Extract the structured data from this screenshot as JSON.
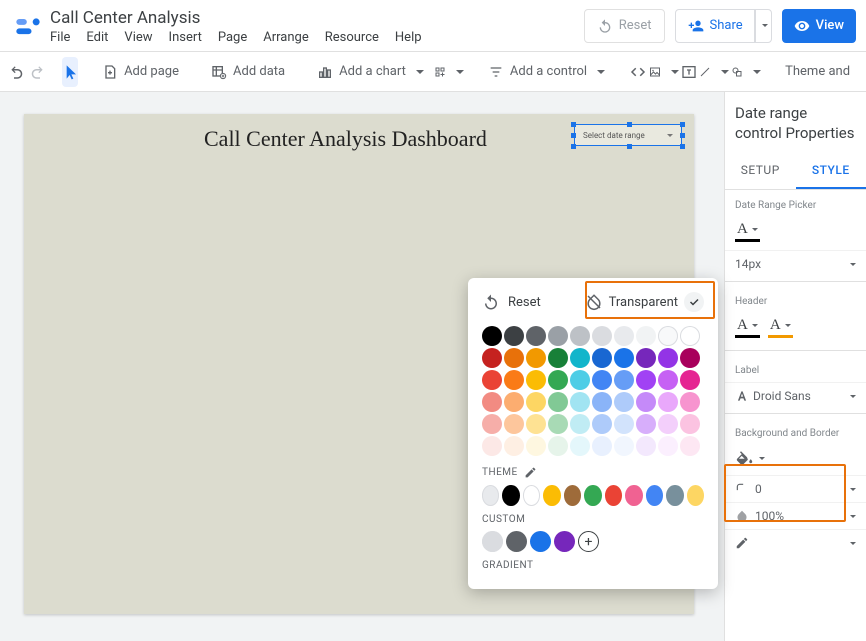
{
  "doc": {
    "title": "Call Center Analysis"
  },
  "menu": {
    "file": "File",
    "edit": "Edit",
    "view": "View",
    "insert": "Insert",
    "page": "Page",
    "arrange": "Arrange",
    "resource": "Resource",
    "help": "Help"
  },
  "title_actions": {
    "reset": "Reset",
    "share": "Share",
    "view": "View"
  },
  "toolbar": {
    "add_page": "Add page",
    "add_data": "Add data",
    "add_chart": "Add a chart",
    "add_control": "Add a control",
    "theme": "Theme and"
  },
  "canvas": {
    "dashboard_title": "Call Center Analysis Dashboard",
    "date_control_label": "Select date range"
  },
  "panel": {
    "title": "Date range control Properties",
    "tab_setup": "SETUP",
    "tab_style": "STYLE",
    "sec_picker": "Date Range Picker",
    "font_size": "14px",
    "sec_header": "Header",
    "sec_label": "Label",
    "label_font": "Droid Sans",
    "sec_bg": "Background and Border",
    "border_radius": "0",
    "opacity": "100%",
    "border_style": "None"
  },
  "picker": {
    "reset": "Reset",
    "transparent": "Transparent",
    "theme_label": "THEME",
    "custom_label": "CUSTOM",
    "gradient_label": "GRADIENT",
    "main_rows": [
      [
        "#000000",
        "#3c4043",
        "#5f6368",
        "#9aa0a6",
        "#bdc1c6",
        "#dadce0",
        "#e8eaed",
        "#f1f3f4",
        "#f8f9fa",
        "#ffffff"
      ],
      [
        "#c5221f",
        "#e8710a",
        "#f29900",
        "#188038",
        "#12b5cb",
        "#1967d2",
        "#1a73e8",
        "#7627bb",
        "#9334e6",
        "#a8005c"
      ],
      [
        "#ea4335",
        "#fa7b17",
        "#fbbc04",
        "#34a853",
        "#4ecde6",
        "#4285f4",
        "#669df6",
        "#a142f4",
        "#c661f4",
        "#e52592"
      ],
      [
        "#f28b82",
        "#fcad70",
        "#fdd663",
        "#81c995",
        "#a1e4f2",
        "#8ab4f8",
        "#aecbfa",
        "#c58af9",
        "#e9a8fb",
        "#f794cf"
      ],
      [
        "#f6aea9",
        "#fdc69c",
        "#fee293",
        "#a8dab5",
        "#c0ecf4",
        "#aecbfa",
        "#d2e3fc",
        "#d7aefb",
        "#f3cffb",
        "#fbc3e1"
      ],
      [
        "#fce8e6",
        "#feefe3",
        "#fef7e0",
        "#e6f4ea",
        "#e4f7fb",
        "#e8f0fe",
        "#f1f6fe",
        "#f3e8fd",
        "#fbeffe",
        "#fde7f3"
      ]
    ],
    "theme_row": [
      "#e8eaed",
      "#000000",
      "#ffffff",
      "#fbbc04",
      "#9e6b3a",
      "#34a853",
      "#ea4335",
      "#f06292",
      "#4285f4",
      "#78909c",
      "#fdd663"
    ],
    "custom_row": [
      "#dadce0",
      "#5f6368",
      "#1a73e8",
      "#7627bb"
    ]
  }
}
